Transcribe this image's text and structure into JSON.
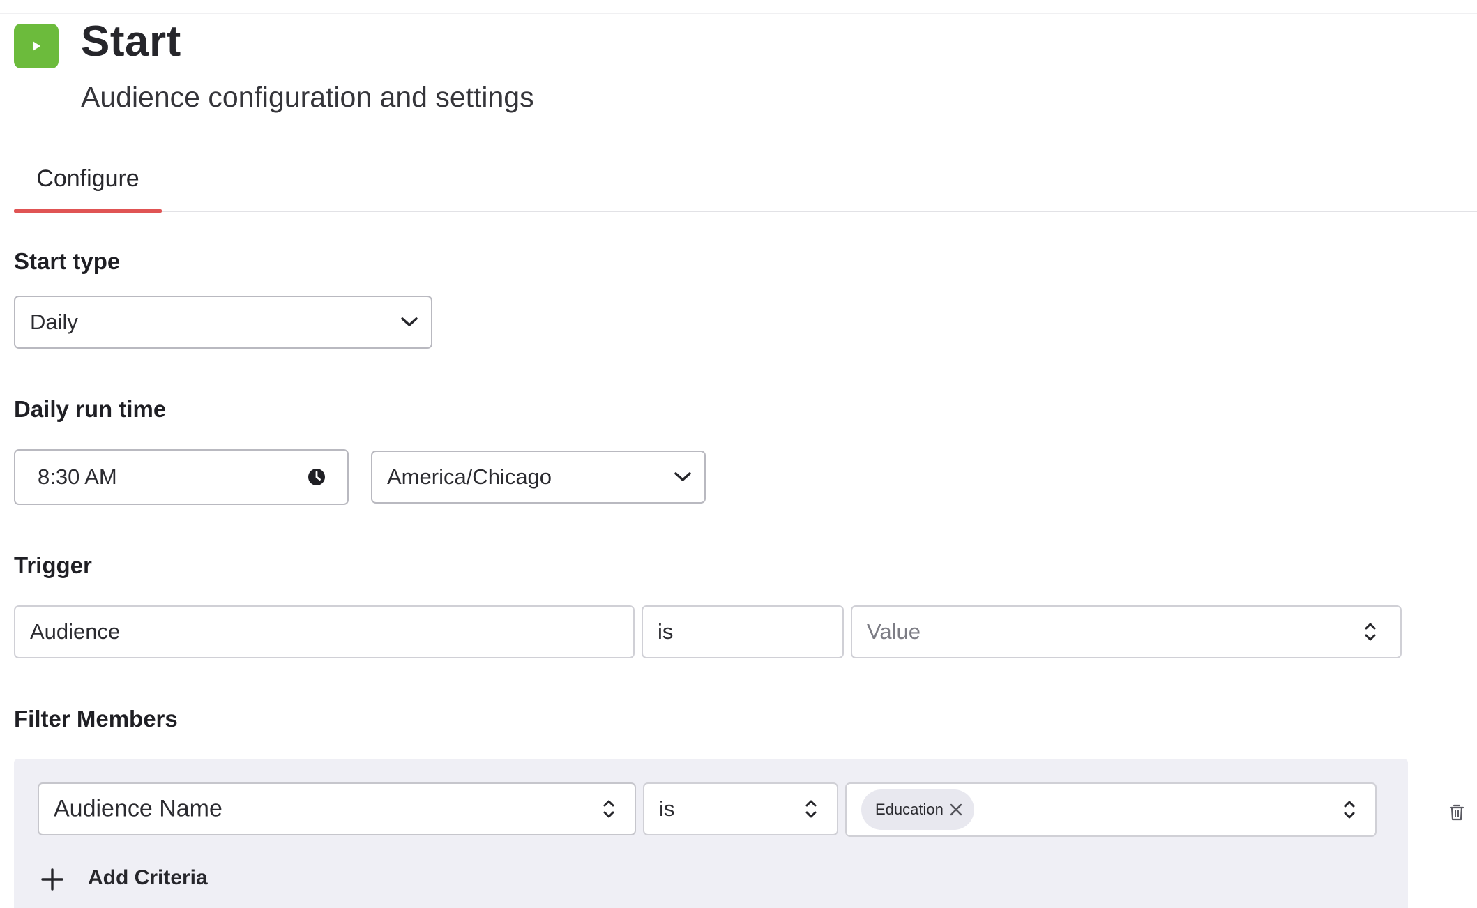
{
  "header": {
    "title": "Start",
    "subtitle": "Audience configuration and settings",
    "icon": "play-icon",
    "icon_color": "#6cbb3c"
  },
  "tabs": [
    {
      "label": "Configure",
      "active": true
    }
  ],
  "accent_color": "#e05454",
  "start_type": {
    "label": "Start type",
    "value": "Daily"
  },
  "daily_run_time": {
    "label": "Daily run time",
    "time_value": "8:30 AM",
    "timezone_value": "America/Chicago"
  },
  "trigger": {
    "label": "Trigger",
    "field_value": "Audience",
    "operator_value": "is",
    "value_placeholder": "Value"
  },
  "filter_members": {
    "label": "Filter Members",
    "criteria": [
      {
        "field": "Audience Name",
        "operator": "is",
        "values": [
          "Education"
        ]
      }
    ],
    "add_label": "Add Criteria"
  }
}
